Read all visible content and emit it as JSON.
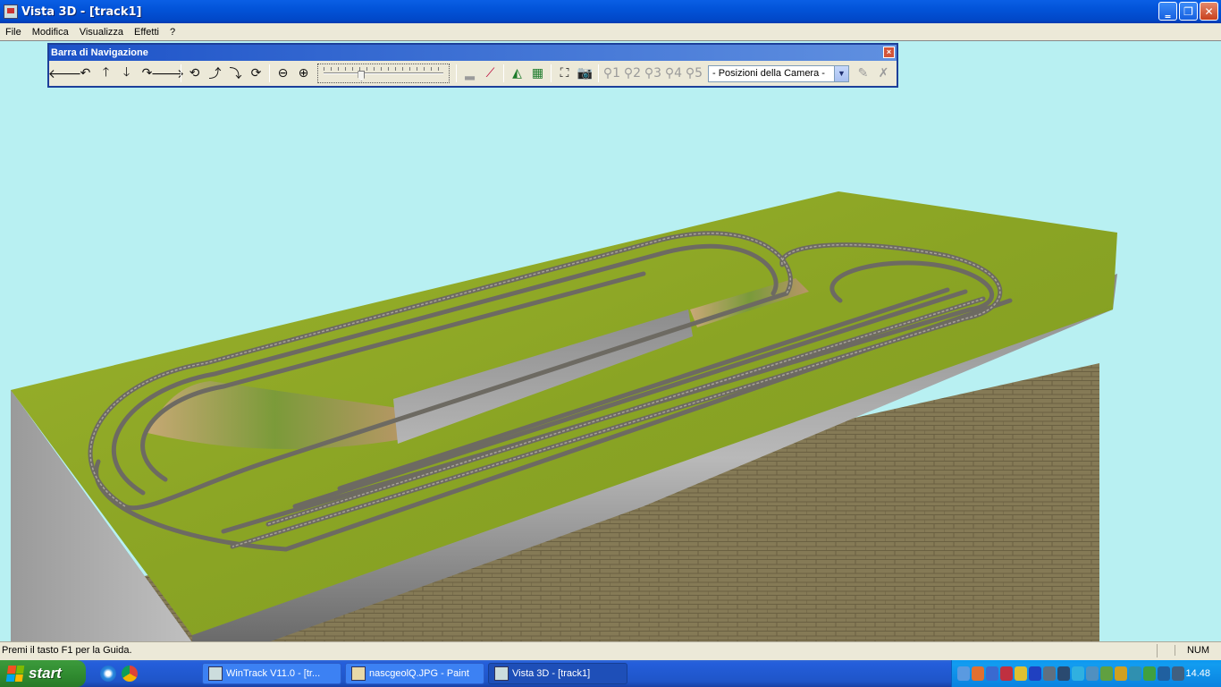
{
  "window": {
    "title": "Vista 3D - [track1]",
    "minimize": "‗",
    "restore": "❐",
    "close": "✕"
  },
  "menu": [
    "File",
    "Modifica",
    "Visualizza",
    "Effetti",
    "?"
  ],
  "navbar": {
    "title": "Barra di Navigazione",
    "close": "×",
    "camera_select": "- Posizioni della Camera -",
    "zoom_level": 0.3
  },
  "statusbar": {
    "text": "Premi il tasto F1 per la Guida.",
    "num": "NUM"
  },
  "taskbar": {
    "start": "start",
    "tasks": [
      {
        "label": "WinTrack  V11.0 - [tr...",
        "active": false
      },
      {
        "label": "nascgeolQ.JPG - Paint",
        "active": false
      },
      {
        "label": "Vista 3D - [track1]",
        "active": true
      }
    ],
    "clock": "14.48"
  },
  "colors": {
    "sky": "#b8f0f2",
    "grass": "#8ea92a",
    "floor": "#857a56",
    "title_blue": "#0253d8"
  }
}
